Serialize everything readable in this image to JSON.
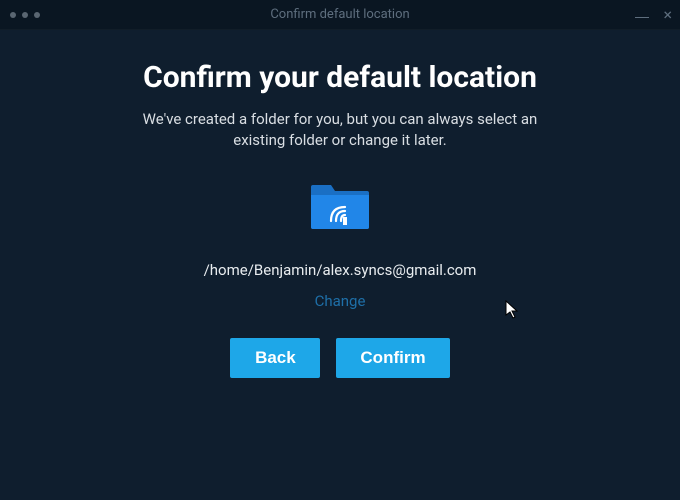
{
  "window": {
    "title": "Confirm default location"
  },
  "heading": "Confirm your default location",
  "subtext": "We've created a folder for you, but you can always select an existing folder or change it later.",
  "location_path": "/home/Benjamin/alex.syncs@gmail.com",
  "change_label": "Change",
  "buttons": {
    "back": "Back",
    "confirm": "Confirm"
  }
}
